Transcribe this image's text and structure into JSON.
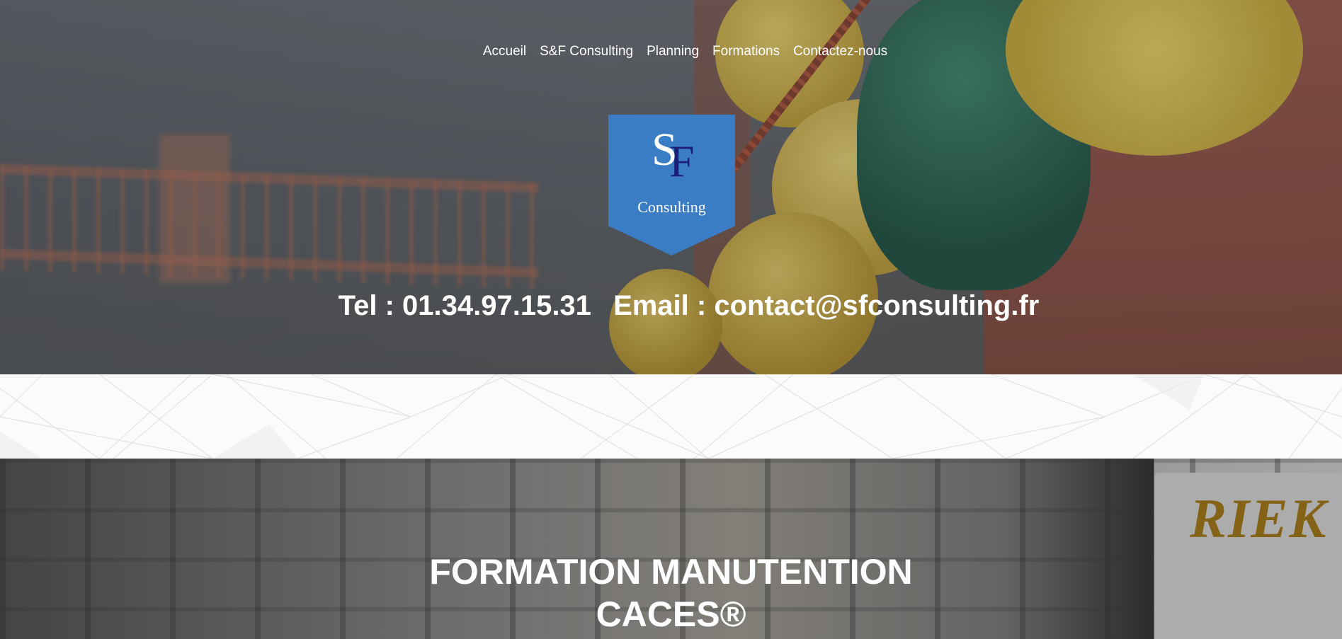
{
  "nav": {
    "items": [
      "Accueil",
      "S&F Consulting",
      "Planning",
      "Formations",
      "Contactez-nous"
    ]
  },
  "logo": {
    "letter_s": "S",
    "letter_f": "F",
    "subtitle": "Consulting",
    "color": "#3a7dc4"
  },
  "contact": {
    "tel": "Tel : 01.34.97.15.31",
    "email": "Email : contact@sfconsulting.fr"
  },
  "section2": {
    "title_line1": "FORMATION MANUTENTION",
    "title_line2": "CACES®"
  }
}
